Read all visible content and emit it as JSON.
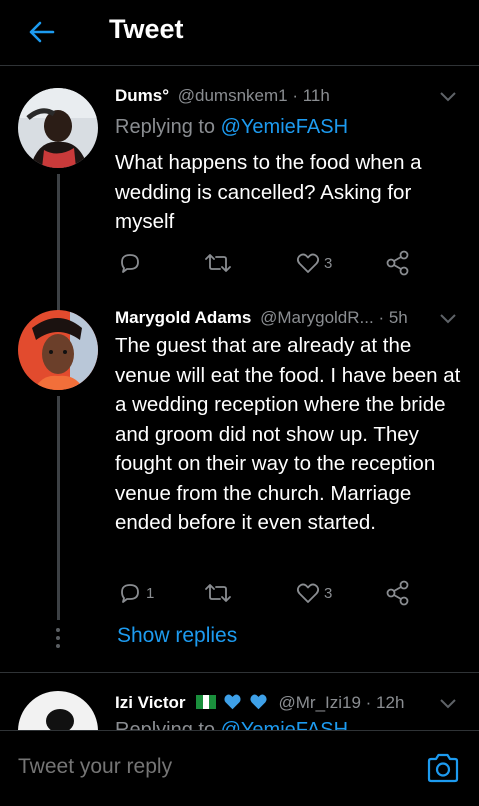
{
  "header": {
    "title": "Tweet"
  },
  "tweets": [
    {
      "name": "Dums°",
      "handle": "@dumsnkem1",
      "time": "· 11h",
      "replying_prefix": "Replying to",
      "replying_to": "@YemieFASH",
      "text": "What happens to the food when a wedding is cancelled? Asking for myself",
      "reply_count": "",
      "retweet_count": "",
      "like_count": "3"
    },
    {
      "name": "Marygold Adams",
      "handle": "@MarygoldR...",
      "time": "· 5h",
      "text": "The guest that are already at the venue will eat the food. I have been at a wedding reception where the bride and groom did not show up. They fought on their way to the reception venue from the church. Marriage ended before it even started.",
      "reply_count": "1",
      "retweet_count": "",
      "like_count": "3"
    },
    {
      "name": "Izi Victor",
      "handle": "@Mr_Izi19",
      "time": "· 12h",
      "replying_prefix": "Replying to",
      "replying_to": "@YemieFASH"
    }
  ],
  "show_replies": "Show replies",
  "composer": {
    "placeholder": "Tweet your reply"
  },
  "colors": {
    "accent": "#1d9bf0",
    "muted": "#8a8d91",
    "background": "#000000"
  },
  "icons": [
    "back-arrow-icon",
    "chevron-down-icon",
    "reply-icon",
    "retweet-icon",
    "like-icon",
    "share-icon",
    "camera-icon",
    "nigeria-flag-icon",
    "blue-heart-icon"
  ]
}
